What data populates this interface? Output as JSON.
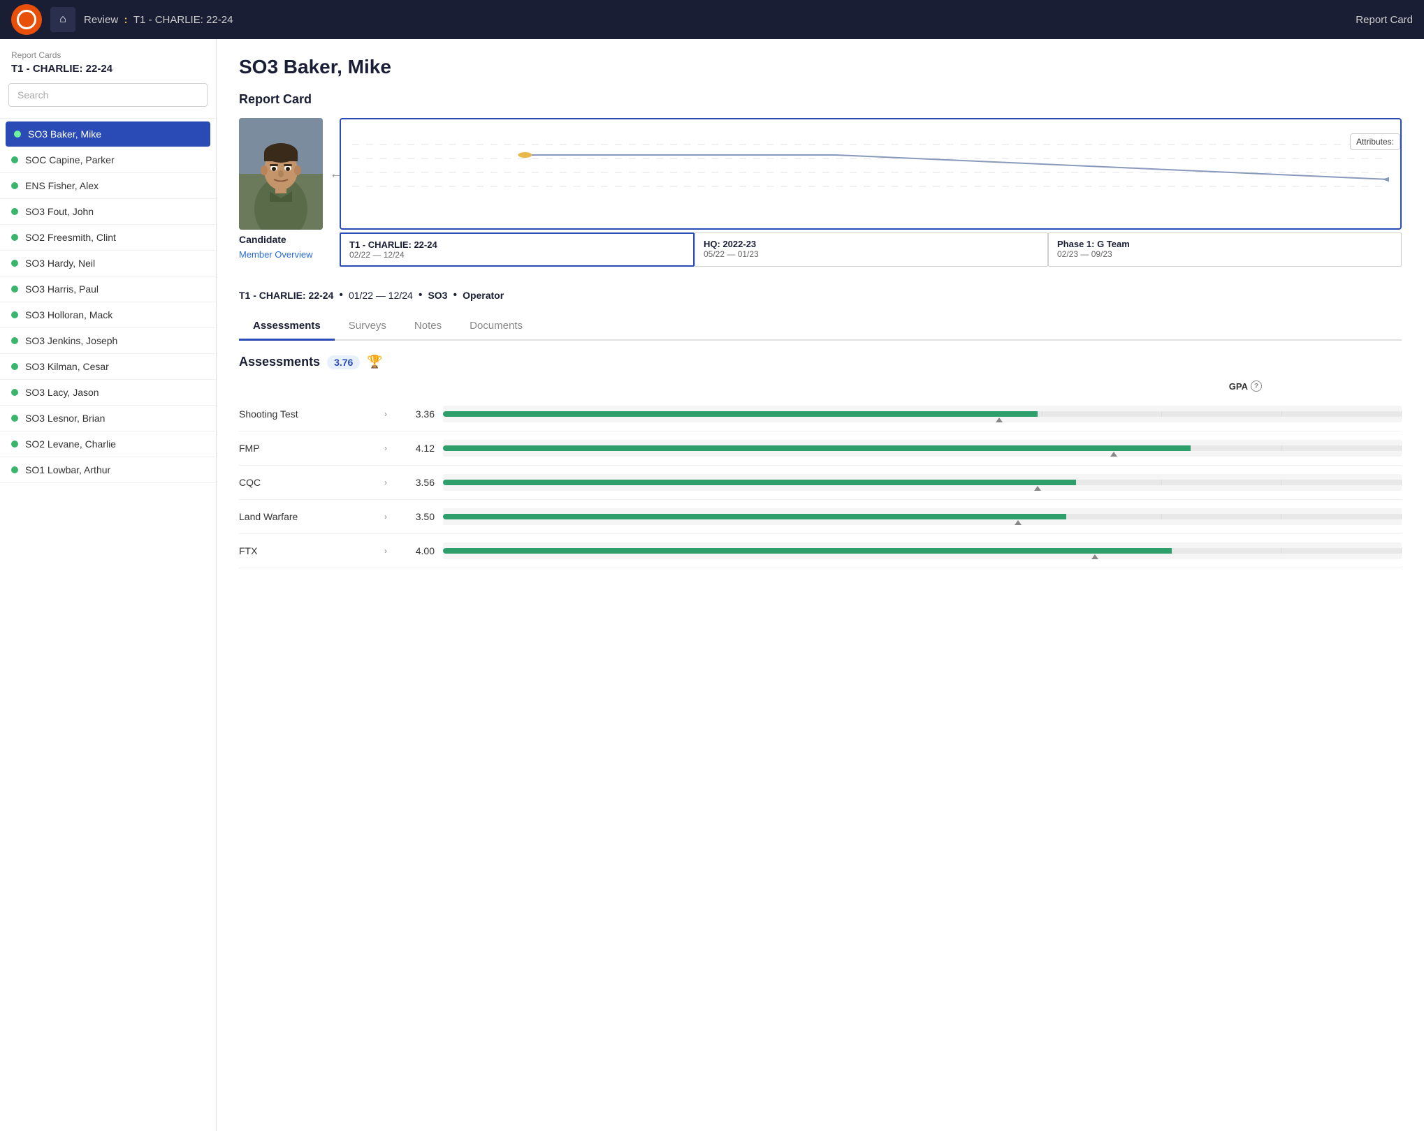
{
  "nav": {
    "breadcrumb_label": "Review",
    "breadcrumb_path": "T1 - CHARLIE: 22-24",
    "report_card_link": "Report Card",
    "home_icon": "🏠"
  },
  "sidebar": {
    "section_label": "Report Cards",
    "group_title": "T1 - CHARLIE: 22-24",
    "search_placeholder": "Search",
    "members": [
      {
        "name": "SO3 Baker, Mike",
        "active": true
      },
      {
        "name": "SOC Capine, Parker",
        "active": false
      },
      {
        "name": "ENS Fisher, Alex",
        "active": false
      },
      {
        "name": "SO3 Fout, John",
        "active": false
      },
      {
        "name": "SO2 Freesmith, Clint",
        "active": false
      },
      {
        "name": "SO3 Hardy, Neil",
        "active": false
      },
      {
        "name": "SO3 Harris, Paul",
        "active": false
      },
      {
        "name": "SO3 Holloran, Mack",
        "active": false
      },
      {
        "name": "SO3 Jenkins, Joseph",
        "active": false
      },
      {
        "name": "SO3 Kilman, Cesar",
        "active": false
      },
      {
        "name": "SO3 Lacy, Jason",
        "active": false
      },
      {
        "name": "SO3 Lesnor, Brian",
        "active": false
      },
      {
        "name": "SO2 Levane, Charlie",
        "active": false
      },
      {
        "name": "SO1 Lowbar, Arthur",
        "active": false
      }
    ]
  },
  "main": {
    "page_title": "SO3 Baker, Mike",
    "report_card_heading": "Report Card",
    "candidate_label": "Candidate",
    "member_overview_link": "Member Overview",
    "timeline_tooltip": "Attributes:",
    "periods": [
      {
        "name": "T1 - CHARLIE: 22-24",
        "date": "02/22 — 12/24",
        "active": true
      },
      {
        "name": "HQ: 2022-23",
        "date": "05/22 — 01/23",
        "active": false
      },
      {
        "name": "Phase 1: G Team",
        "date": "02/23 — 09/23",
        "active": false
      }
    ],
    "status_line": {
      "group": "T1 - CHARLIE: 22-24",
      "date_range": "01/22 — 12/24",
      "rank": "SO3",
      "role": "Operator"
    },
    "tabs": [
      "Assessments",
      "Surveys",
      "Notes",
      "Documents"
    ],
    "active_tab": "Assessments",
    "assessments": {
      "title": "Assessments",
      "score": "3.76",
      "gpa_column": "GPA",
      "rows": [
        {
          "name": "Shooting Test",
          "gpa": "3.36",
          "bar_pct": 62,
          "tick_pct": 58
        },
        {
          "name": "FMP",
          "gpa": "4.12",
          "bar_pct": 78,
          "tick_pct": 70
        },
        {
          "name": "CQC",
          "gpa": "3.56",
          "bar_pct": 66,
          "tick_pct": 62
        },
        {
          "name": "Land Warfare",
          "gpa": "3.50",
          "bar_pct": 65,
          "tick_pct": 60
        },
        {
          "name": "FTX",
          "gpa": "4.00",
          "bar_pct": 76,
          "tick_pct": 68
        }
      ]
    }
  }
}
